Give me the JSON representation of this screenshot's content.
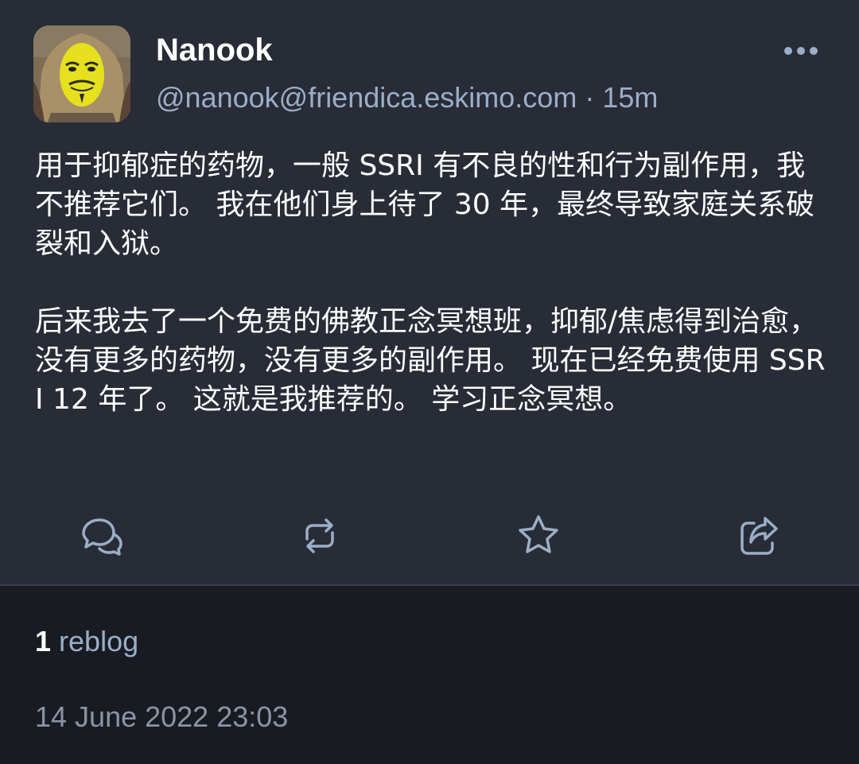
{
  "account": {
    "display_name": "Nanook",
    "handle": "@nanook@friendica.eskimo.com",
    "separator": " · ",
    "relative_time": "15m"
  },
  "content": {
    "paragraphs": [
      "用于抑郁症的药物，一般 SSRI 有不良的性和行为副作用，我不推荐它们。 我在他们身上待了 30 年，最终导致家庭关系破裂和入狱。",
      "后来我去了一个免费的佛教正念冥想班，抑郁/焦虑得到治愈，没有更多的药物，没有更多的副作用。 现在已经免费使用 SSRI 12 年了。 这就是我推荐的。 学习正念冥想。"
    ]
  },
  "actions": {
    "reply_icon": "reply-icon",
    "boost_icon": "boost-icon",
    "favourite_icon": "star-icon",
    "share_icon": "share-icon",
    "more_icon": "more-icon"
  },
  "stats": {
    "reblog_count": "1",
    "reblog_label": " reblog"
  },
  "timestamp": "14 June 2022 23:03",
  "colors": {
    "post_background": "#282c37",
    "page_background": "#191b22",
    "secondary_text": "#9baec8",
    "icon": "#9baec8"
  }
}
